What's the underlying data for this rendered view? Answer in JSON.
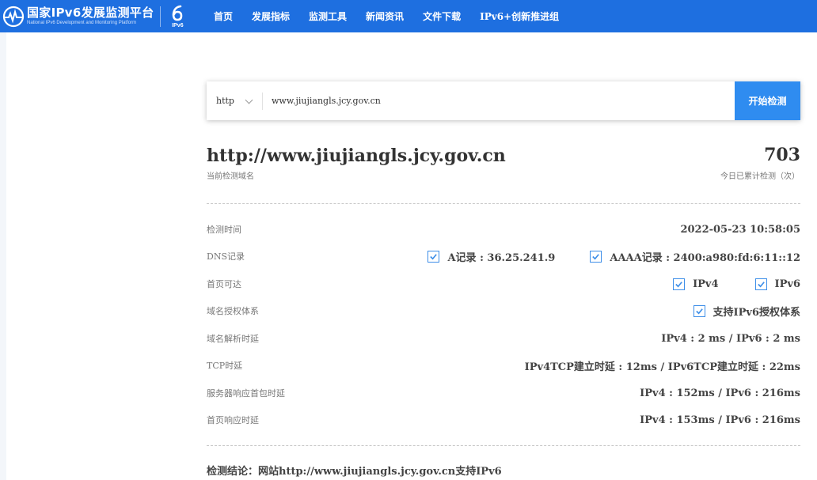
{
  "brand": {
    "name_cn": "国家IPv6发展监测平台",
    "name_en": "National IPv6 Development and Monitoring Platform",
    "badge": "IPv6",
    "colors": {
      "nav": "#1e6fe0",
      "button": "#2f8cf0",
      "check": "#3d8ee8"
    }
  },
  "nav": {
    "items": [
      "首页",
      "发展指标",
      "监测工具",
      "新闻资讯",
      "文件下载",
      "IPv6+创新推进组"
    ]
  },
  "search": {
    "protocol": "http",
    "value": "www.jiujiangls.jcy.gov.cn",
    "button": "开始检测"
  },
  "summary": {
    "domain": "http://www.jiujiangls.jcy.gov.cn",
    "domain_label": "当前检测域名",
    "count": "703",
    "count_label": "今日已累计检测（次）"
  },
  "results": {
    "time": {
      "label": "检测时间",
      "value": "2022-05-23 10:58:05"
    },
    "dns": {
      "label": "DNS记录",
      "a": "A记录 : 36.25.241.9",
      "aaaa": "AAAA记录 : 2400:a980:fd:6:11::12"
    },
    "homepage": {
      "label": "首页可达",
      "v4": "IPv4",
      "v6": "IPv6"
    },
    "auth": {
      "label": "域名授权体系",
      "value": "支持IPv6授权体系"
    },
    "dns_delay": {
      "label": "域名解析时延",
      "value": "IPv4 : 2 ms / IPv6 : 2 ms"
    },
    "tcp": {
      "label": "TCP时延",
      "value": "IPv4TCP建立时延 : 12ms / IPv6TCP建立时延 : 22ms"
    },
    "first_packet": {
      "label": "服务器响应首包时延",
      "value": "IPv4 : 152ms / IPv6 : 216ms"
    },
    "page_load": {
      "label": "首页响应时延",
      "value": "IPv4 : 153ms / IPv6 : 216ms"
    }
  },
  "conclusion": "检测结论：网站http://www.jiujiangls.jcy.gov.cn支持IPv6"
}
